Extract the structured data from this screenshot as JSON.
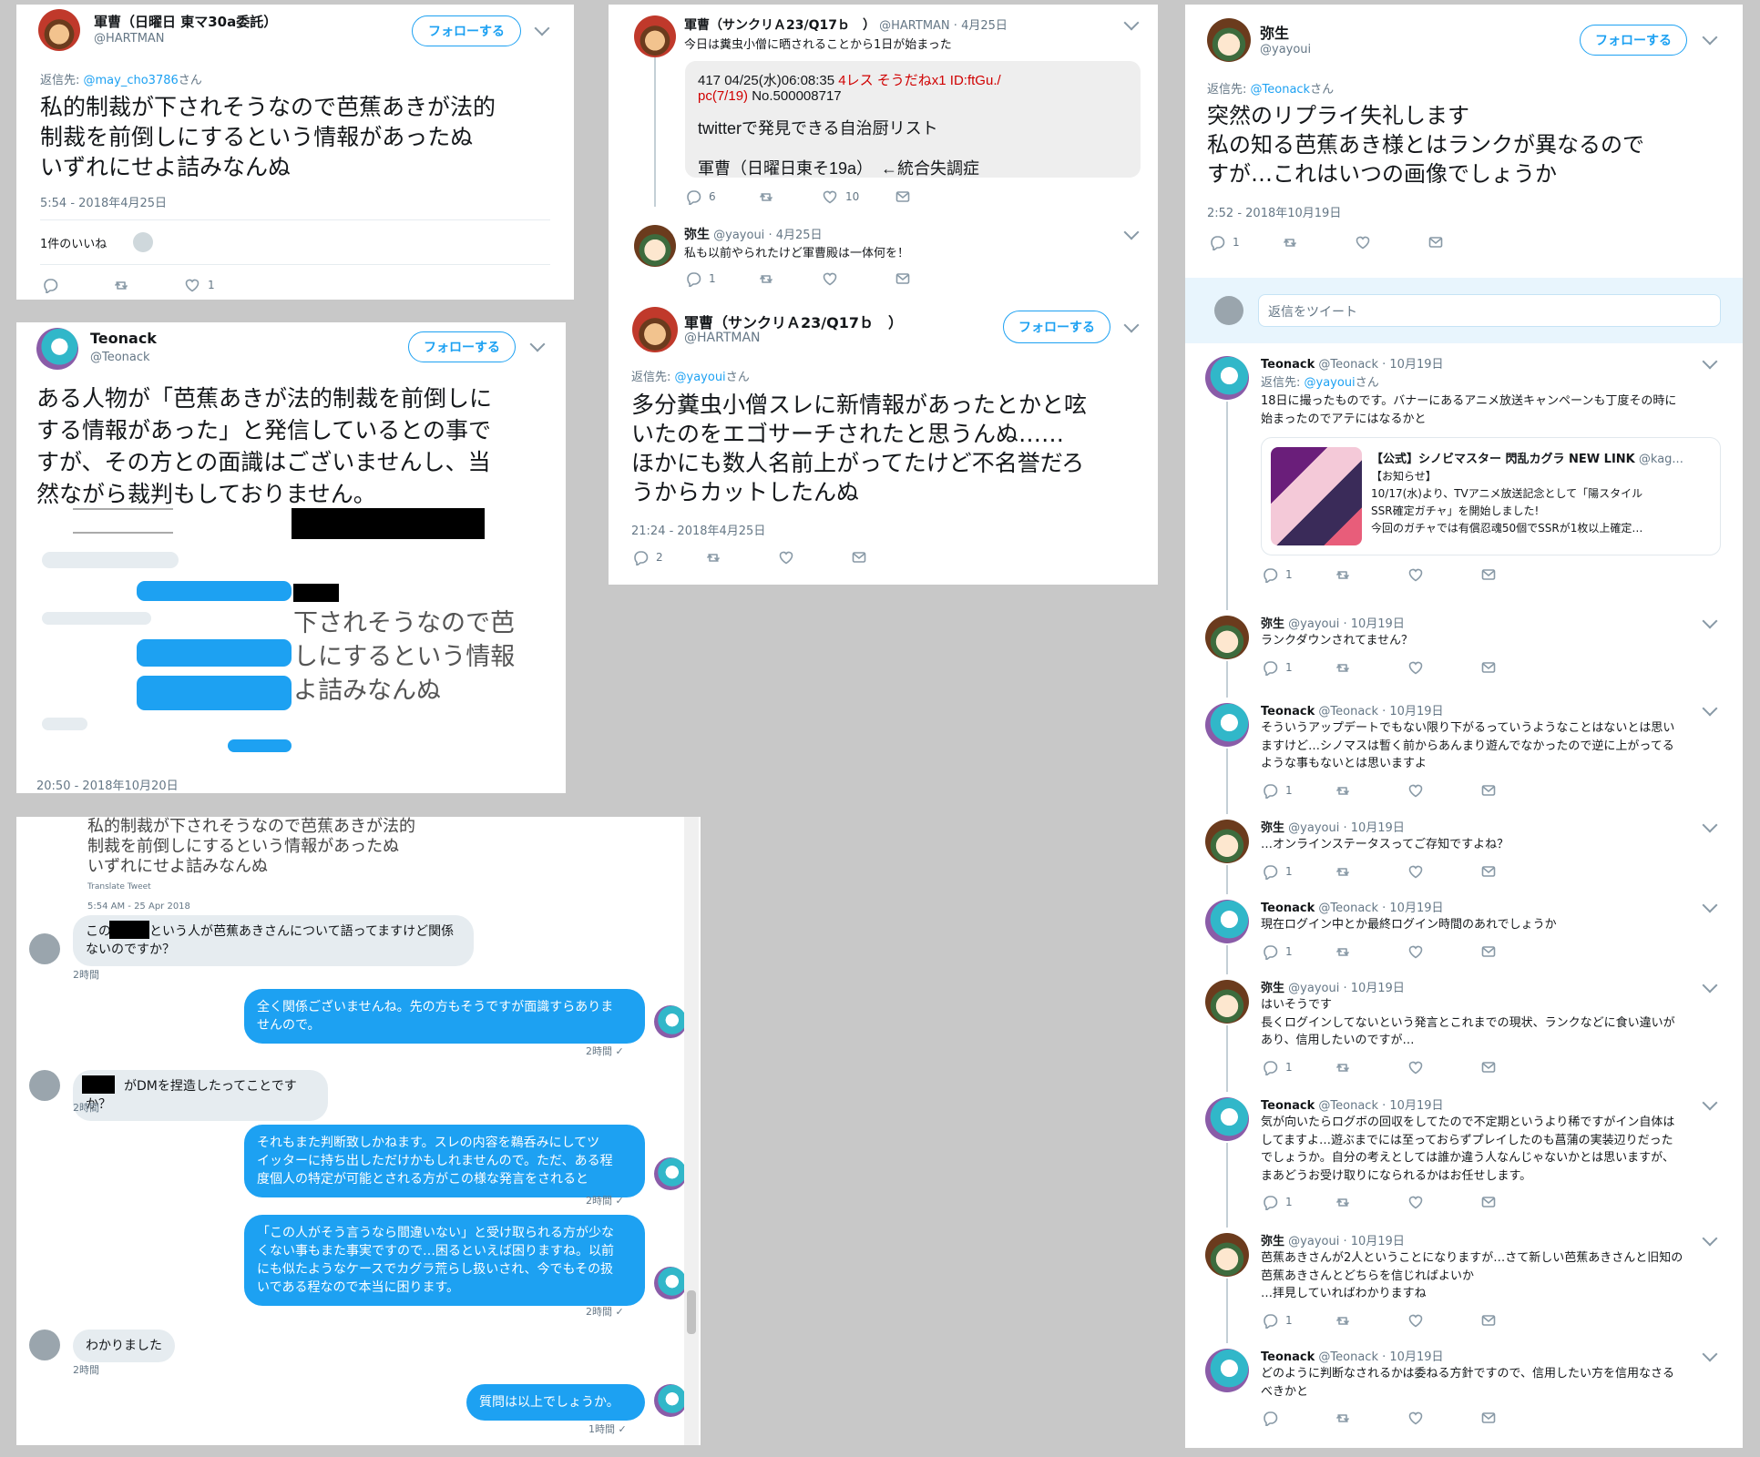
{
  "panel1": {
    "name": "軍曹（日曜日 東マ30a委託）",
    "handle": "@HARTMAN",
    "follow": "フォローする",
    "reply_to_prefix": "返信先: ",
    "reply_to_user": "@may_cho3786",
    "reply_to_suffix": "さん",
    "text": [
      "私的制裁が下されそうなので芭蕉あきが法的",
      "制裁を前倒しにするという情報があったぬ",
      "いずれにせよ詰みなんぬ"
    ],
    "timestamp": "5:54 - 2018年4月25日",
    "likes_label": "1件のいいね",
    "like_count": "1"
  },
  "panel2": {
    "name": "Teonack",
    "handle": "@Teonack",
    "follow": "フォローする",
    "text": [
      "ある人物が「芭蕉あきが法的制裁を前倒しに",
      "する情報があった」と発信しているとの事で",
      "すが、その方との面識はございませんし、当",
      "然ながら裁判もしておりません。"
    ],
    "crop_text": [
      "下されそうなので芭",
      "しにするという情報",
      "よ詰みなんぬ"
    ],
    "timestamp": "20:50 - 2018年10月20日"
  },
  "panel3": {
    "tweet1_name": "軍曹（サンクリＡ23/Q17ｂ　）",
    "tweet1_handle": "@HARTMAN",
    "tweet1_date": "4月25日",
    "tweet1_text": "今日は糞虫小僧に晒されることから1日が始まった",
    "quote_line1_a": "417 04/25(水)06:08:35 ",
    "quote_line1_b": "4レス そうだねx1 ID:ftGu./",
    "quote_line2_a": "pc(7/19) ",
    "quote_line2_b": "No.500008717",
    "quote_line3": "twitterで発見できる自治厨リスト",
    "quote_line4": "軍曹（日曜日東そ19a）　←統合失調症",
    "tweet1_replies": "6",
    "tweet1_likes": "10",
    "tweet2_name": "弥生",
    "tweet2_handle": "@yayoui",
    "tweet2_date": "4月25日",
    "tweet2_text": "私も以前やられたけど軍曹殿は一体何を！",
    "tweet2_replies": "1",
    "main_name": "軍曹（サンクリＡ23/Q17ｂ　）",
    "main_handle": "@HARTMAN",
    "follow": "フォローする",
    "reply_to_prefix": "返信先: ",
    "reply_to_user": "@yayoui",
    "reply_to_suffix": "さん",
    "main_text": [
      "多分糞虫小僧スレに新情報があったとかと呟",
      "いたのをエゴサーチされたと思うんぬ……",
      "ほかにも数人名前上がってたけど不名誉だろ",
      "うからカットしたんぬ"
    ],
    "timestamp": "21:24 - 2018年4月25日",
    "reply_count": "2"
  },
  "panel4": {
    "tweet_text": [
      "私的制裁が下されそうなので芭蕉あきが法的",
      "制裁を前倒しにするという情報があったぬ",
      "いずれにせよ詰みなんぬ"
    ],
    "translate": "Translate Tweet",
    "tweet_time": "5:54 AM - 25 Apr 2018",
    "messages": [
      {
        "side": "L",
        "lines": [
          "この　　　という人が芭蕉あきさんについて語ってますけど関係",
          "ないのですか？"
        ],
        "time": "2時間"
      },
      {
        "side": "R",
        "lines": [
          "全く関係ございませんね。先の方もそうですが面識すらありま",
          "せんので。"
        ],
        "time": "2時間 ✓"
      },
      {
        "side": "L",
        "lines": [
          "　　　がDMを捏造したってことですか？"
        ],
        "time": "2時間"
      },
      {
        "side": "R",
        "lines": [
          "それもまた判断致しかねます。スレの内容を鵜呑みにしてツ",
          "イッターに持ち出しただけかもしれませんので。ただ、ある程",
          "度個人の特定が可能とされる方がこの様な発言をされると"
        ],
        "time": "2時間 ✓"
      },
      {
        "side": "R",
        "lines": [
          "「この人がそう言うなら間違いない」と受け取られる方が少な",
          "くない事もまた事実ですので…困るといえば困りますね。以前",
          "にも似たようなケースでカグラ荒らし扱いされ、今でもその扱",
          "いである程なので本当に困ります。"
        ],
        "time": "2時間 ✓"
      },
      {
        "side": "L",
        "lines": [
          "わかりました"
        ],
        "time": "2時間"
      },
      {
        "side": "R",
        "lines": [
          "質問は以上でしょうか。"
        ],
        "time": "1時間 ✓"
      }
    ]
  },
  "panel5": {
    "name": "弥生",
    "handle": "@yayoui",
    "follow": "フォローする",
    "reply_to_prefix": "返信先: ",
    "reply_to_user": "@Teonack",
    "reply_to_suffix": "さん",
    "text": [
      "突然のリプライ失礼します",
      "私の知る芭蕉あき様とはランクが異なるので",
      "すが…これはいつの画像でしょうか"
    ],
    "timestamp": "2:52 - 2018年10月19日",
    "reply_count": "1",
    "reply_placeholder": "返信をツイート",
    "card": {
      "title": "【公式】シノビマスター 閃乱カグラ NEW LINK",
      "handle": "@kag...",
      "line1": "【お知らせ】",
      "line2": "10/17(水)より、TVアニメ放送記念として「陽スタイル",
      "line3": "SSR確定ガチャ」を開始しました!",
      "line4": "今回のガチャでは有償忍魂50個でSSRが1枚以上確定…"
    },
    "replies": [
      {
        "who": "T",
        "name": "Teonack",
        "handle": "@Teonack",
        "date": "10月19日",
        "reply_to": "@yayoui",
        "lines": [
          "18日に撮ったものです。バナーにあるアニメ放送キャンペーンも丁度その時に",
          "始まったのでアテにはなるかと"
        ],
        "count": "1"
      },
      {
        "who": "Y",
        "name": "弥生",
        "handle": "@yayoui",
        "date": "10月19日",
        "lines": [
          "ランクダウンされてません？"
        ],
        "count": "1"
      },
      {
        "who": "T",
        "name": "Teonack",
        "handle": "@Teonack",
        "date": "10月19日",
        "lines": [
          "そういうアップデートでもない限り下がるっていうようなことはないとは思い",
          "ますけど…シノマスは暫く前からあんまり遊んでなかったので逆に上がってる",
          "ような事もないとは思いますよ"
        ],
        "count": "1"
      },
      {
        "who": "Y",
        "name": "弥生",
        "handle": "@yayoui",
        "date": "10月19日",
        "lines": [
          "…オンラインステータスってご存知ですよね？"
        ],
        "count": "1"
      },
      {
        "who": "T",
        "name": "Teonack",
        "handle": "@Teonack",
        "date": "10月19日",
        "lines": [
          "現在ログイン中とか最終ログイン時間のあれでしょうか"
        ],
        "count": "1"
      },
      {
        "who": "Y",
        "name": "弥生",
        "handle": "@yayoui",
        "date": "10月19日",
        "lines": [
          "はいそうです",
          "長くログインしてないという発言とこれまでの現状、ランクなどに食い違いが",
          "あり、信用したいのですが…"
        ],
        "count": "1"
      },
      {
        "who": "T",
        "name": "Teonack",
        "handle": "@Teonack",
        "date": "10月19日",
        "lines": [
          "気が向いたらログボの回収をしてたので不定期というより稀ですがイン自体は",
          "してますよ…遊ぶまでには至っておらずプレイしたのも菖蒲の実装辺りだった",
          "でしょうか。自分の考えとしては誰か違う人なんじゃないかとは思いますが、",
          "まあどうお受け取りになられるかはお任せします。"
        ],
        "count": "1"
      },
      {
        "who": "Y",
        "name": "弥生",
        "handle": "@yayoui",
        "date": "10月19日",
        "lines": [
          "芭蕉あきさんが2人ということになりますが…さて新しい芭蕉あきさんと旧知の",
          "芭蕉あきさんとどちらを信じればよいか",
          "…拝見していればわかりますね"
        ],
        "count": "1"
      },
      {
        "who": "T",
        "name": "Teonack",
        "handle": "@Teonack",
        "date": "10月19日",
        "lines": [
          "どのように判断なされるかは委ねる方針ですので、信用したい方を信用なさる",
          "べきかと"
        ],
        "count": ""
      }
    ]
  },
  "colors": {
    "accent": "#1da1f2",
    "muted": "#657786",
    "red": "#d00000",
    "quote_bg": "#eeeeee"
  },
  "icons": [
    "reply-icon",
    "retweet-icon",
    "like-icon",
    "dm-icon",
    "chevron-down-icon"
  ]
}
